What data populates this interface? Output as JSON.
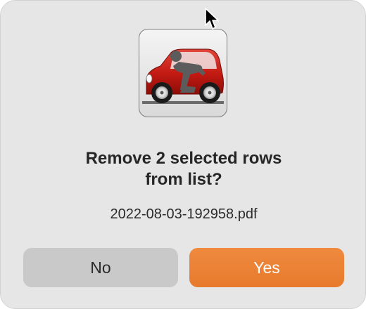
{
  "dialog": {
    "icon_name": "car-icon",
    "message_lines": [
      "Remove 2 selected rows",
      "from list?"
    ],
    "detail": "2022-08-03-192958.pdf",
    "buttons": {
      "no_label": "No",
      "yes_label": "Yes"
    }
  },
  "colors": {
    "dialog_background": "#e6e6e6",
    "default_button": "#e77a2c",
    "secondary_button": "#c9c9c9",
    "car_body": "#c21a12"
  }
}
